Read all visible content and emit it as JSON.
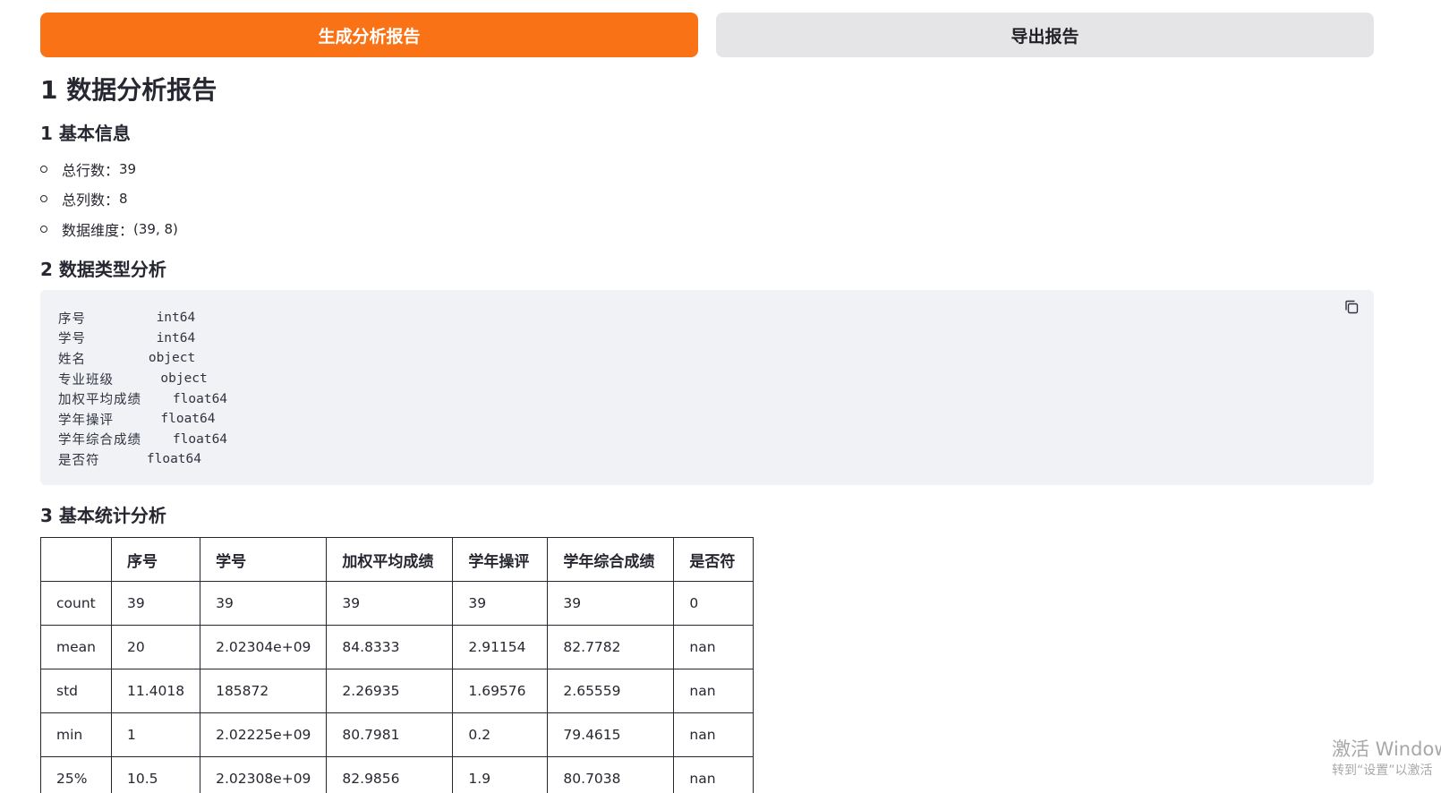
{
  "buttons": {
    "generate_label": "生成分析报告",
    "export_label": "导出报告"
  },
  "report": {
    "title": "1 数据分析报告",
    "basic_info": {
      "heading": "1 基本信息",
      "items": [
        {
          "label": "总行数：",
          "value": "39"
        },
        {
          "label": "总列数：",
          "value": "8"
        },
        {
          "label": "数据维度：",
          "value": "(39, 8)"
        }
      ]
    },
    "dtypes": {
      "heading": "2 数据类型分析",
      "rows": [
        {
          "name": "序号",
          "pad": "         ",
          "type": "int64"
        },
        {
          "name": "学号",
          "pad": "         ",
          "type": "int64"
        },
        {
          "name": "姓名",
          "pad": "        ",
          "type": "object"
        },
        {
          "name": "专业班级",
          "pad": "      ",
          "type": "object"
        },
        {
          "name": "加权平均成绩",
          "pad": "    ",
          "type": "float64"
        },
        {
          "name": "学年操评",
          "pad": "      ",
          "type": "float64"
        },
        {
          "name": "学年综合成绩",
          "pad": "    ",
          "type": "float64"
        },
        {
          "name": "是否符",
          "pad": "      ",
          "type": "float64"
        }
      ]
    },
    "stats": {
      "heading": "3 基本统计分析",
      "columns": [
        "",
        "序号",
        "学号",
        "加权平均成绩",
        "学年操评",
        "学年综合成绩",
        "是否符"
      ],
      "rows": [
        [
          "count",
          "39",
          "39",
          "39",
          "39",
          "39",
          "0"
        ],
        [
          "mean",
          "20",
          "2.02304e+09",
          "84.8333",
          "2.91154",
          "82.7782",
          "nan"
        ],
        [
          "std",
          "11.4018",
          "185872",
          "2.26935",
          "1.69576",
          "2.65559",
          "nan"
        ],
        [
          "min",
          "1",
          "2.02225e+09",
          "80.7981",
          "0.2",
          "79.4615",
          "nan"
        ],
        [
          "25%",
          "10.5",
          "2.02308e+09",
          "82.9856",
          "1.9",
          "80.7038",
          "nan"
        ]
      ]
    }
  },
  "watermark": {
    "line1": "激活 Windows",
    "line2": "转到“设置”以激活"
  },
  "colors": {
    "primary": "#f97316",
    "secondary": "#e5e5e7",
    "code_bg": "#f0f2f6"
  }
}
